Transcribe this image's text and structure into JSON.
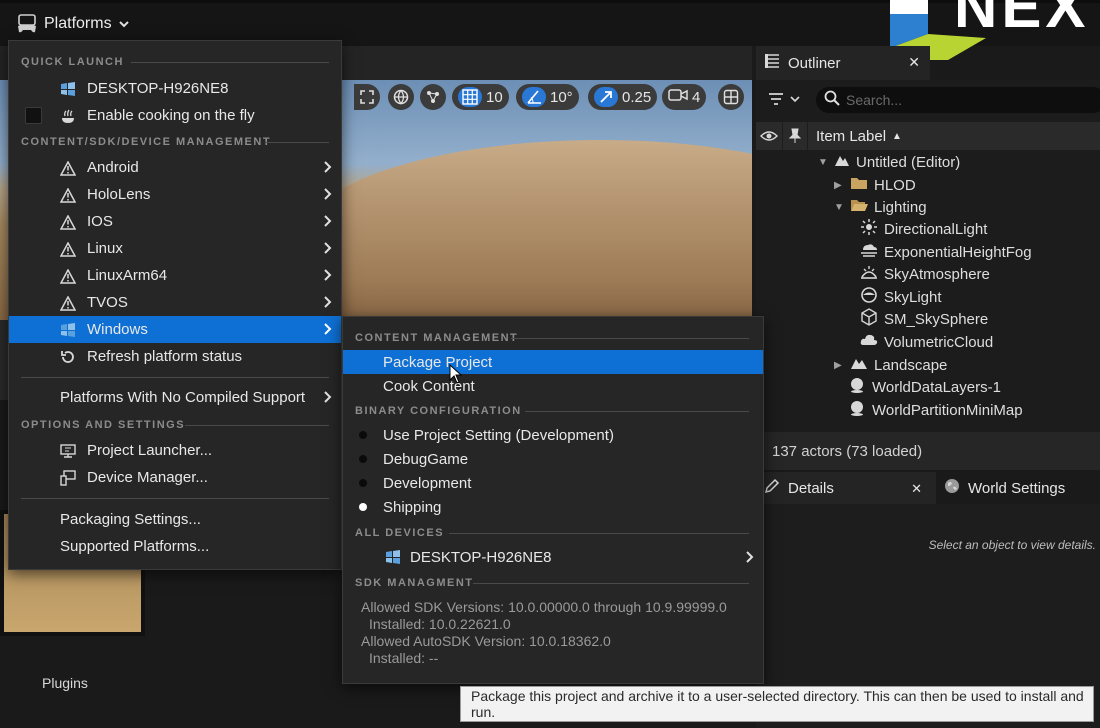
{
  "topbar": {
    "platforms_label": "Platforms",
    "logo_text": "NEX"
  },
  "viewport_toolbar": {
    "grid_value": "10",
    "angle_value": "10°",
    "scale_value": "0.25",
    "camera_value": "4"
  },
  "outliner": {
    "tab_label": "Outliner",
    "search_placeholder": "Search...",
    "column_label": "Item Label",
    "tree": [
      {
        "label": "Untitled (Editor)"
      },
      {
        "label": "HLOD"
      },
      {
        "label": "Lighting"
      },
      {
        "label": "DirectionalLight"
      },
      {
        "label": "ExponentialHeightFog"
      },
      {
        "label": "SkyAtmosphere"
      },
      {
        "label": "SkyLight"
      },
      {
        "label": "SM_SkySphere"
      },
      {
        "label": "VolumetricCloud"
      },
      {
        "label": "Landscape"
      },
      {
        "label": "WorldDataLayers-1"
      },
      {
        "label": "WorldPartitionMiniMap"
      }
    ],
    "status": "137 actors (73 loaded)"
  },
  "details": {
    "tab_label": "Details",
    "world_settings_label": "World Settings",
    "empty_text": "Select an object to view details."
  },
  "menu": {
    "quick_launch_header": "QUICK LAUNCH",
    "device_item": "DESKTOP-H926NE8",
    "cook_on_fly": "Enable cooking on the fly",
    "content_header": "CONTENT/SDK/DEVICE MANAGEMENT",
    "platforms": [
      "Android",
      "HoloLens",
      "IOS",
      "Linux",
      "LinuxArm64",
      "TVOS",
      "Windows"
    ],
    "refresh": "Refresh platform status",
    "no_compiled": "Platforms With No Compiled Support",
    "options_header": "OPTIONS AND SETTINGS",
    "project_launcher": "Project Launcher...",
    "device_manager": "Device Manager...",
    "packaging_settings": "Packaging Settings...",
    "supported_platforms": "Supported Platforms..."
  },
  "submenu": {
    "content_header": "CONTENT MANAGEMENT",
    "package_project": "Package Project",
    "cook_content": "Cook Content",
    "binary_header": "BINARY CONFIGURATION",
    "configs": [
      {
        "label": "Use Project Setting (Development)",
        "selected": false
      },
      {
        "label": "DebugGame",
        "selected": false
      },
      {
        "label": "Development",
        "selected": false
      },
      {
        "label": "Shipping",
        "selected": true
      }
    ],
    "all_devices_header": "ALL DEVICES",
    "device": "DESKTOP-H926NE8",
    "sdk_header": "SDK MANAGMENT",
    "sdk_lines": [
      "Allowed SDK Versions: 10.0.00000.0 through 10.9.99999.0",
      "Installed: 10.0.22621.0",
      "Allowed AutoSDK Version: 10.0.18362.0",
      "Installed: --"
    ]
  },
  "plugins_label": "Plugins",
  "tooltip": "Package this project and archive it to a user-selected directory. This can then be used to install and run.",
  "colors": {
    "accent": "#0e70d4",
    "menu_bg": "#262626",
    "panel_bg": "#1c1c1c"
  }
}
